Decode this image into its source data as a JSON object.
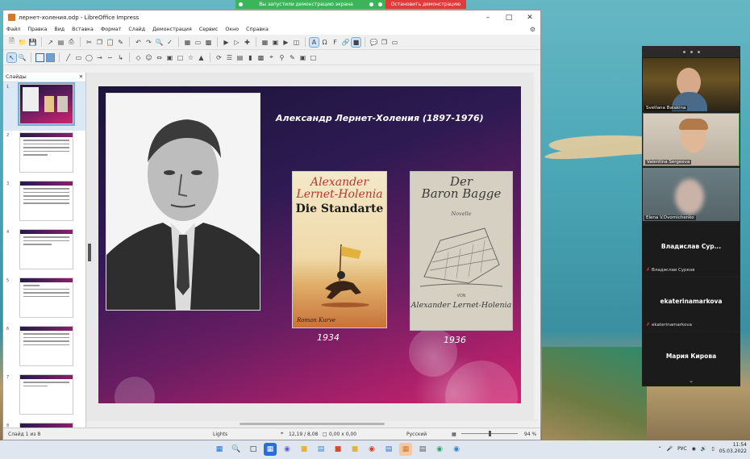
{
  "share_bar": {
    "message": "Вы запустили демонстрацию экрана",
    "stop_label": "Остановить демонстрацию"
  },
  "window": {
    "title": "лернет-холения.odp - LibreOffice Impress",
    "menu": [
      "Файл",
      "Правка",
      "Вид",
      "Вставка",
      "Формат",
      "Слайд",
      "Демонстрация",
      "Сервис",
      "Окно",
      "Справка"
    ]
  },
  "slides_pane": {
    "header": "Слайды",
    "numbers": [
      "1",
      "2",
      "3",
      "4",
      "5",
      "6",
      "7",
      "8"
    ]
  },
  "slide": {
    "title": "Александр Лернет-Холения (1897-1976)",
    "book1": {
      "author_line1": "Alexander",
      "author_line2": "Lernet-Holenia",
      "title": "Die Standarte",
      "publisher": "Roman Kurve",
      "year": "1934"
    },
    "book2": {
      "title_line1": "Der",
      "title_line2": "Baron Bagge",
      "genre": "Novelle",
      "by": "VON",
      "author": "Alexander Lernet-Holenia",
      "year": "1936"
    }
  },
  "status": {
    "slide": "Слайд 1 из 8",
    "layout": "Lights",
    "position": "12,19 / 8,08",
    "size": "0,00 x 0,00",
    "language": "Русский",
    "zoom": "94 %"
  },
  "participants": [
    {
      "name": "Svetlana Balakina"
    },
    {
      "name": "Valentina Sergeeva"
    },
    {
      "name": "Elena V.Dvornichenko"
    },
    {
      "display": "Владислав  Сур...",
      "name": "Владислав Сурков"
    },
    {
      "display": "ekaterinamarkova",
      "name": "ekaterinamarkova"
    },
    {
      "display": "Мария Кирова",
      "name": "Мария Кирова"
    }
  ],
  "taskbar": {
    "lang": "РУС",
    "time": "11:54",
    "date": "05.03.2022"
  },
  "colors": {
    "share_green": "#3cb55a",
    "share_red": "#e03a3a",
    "accent": "#7aaad8"
  }
}
